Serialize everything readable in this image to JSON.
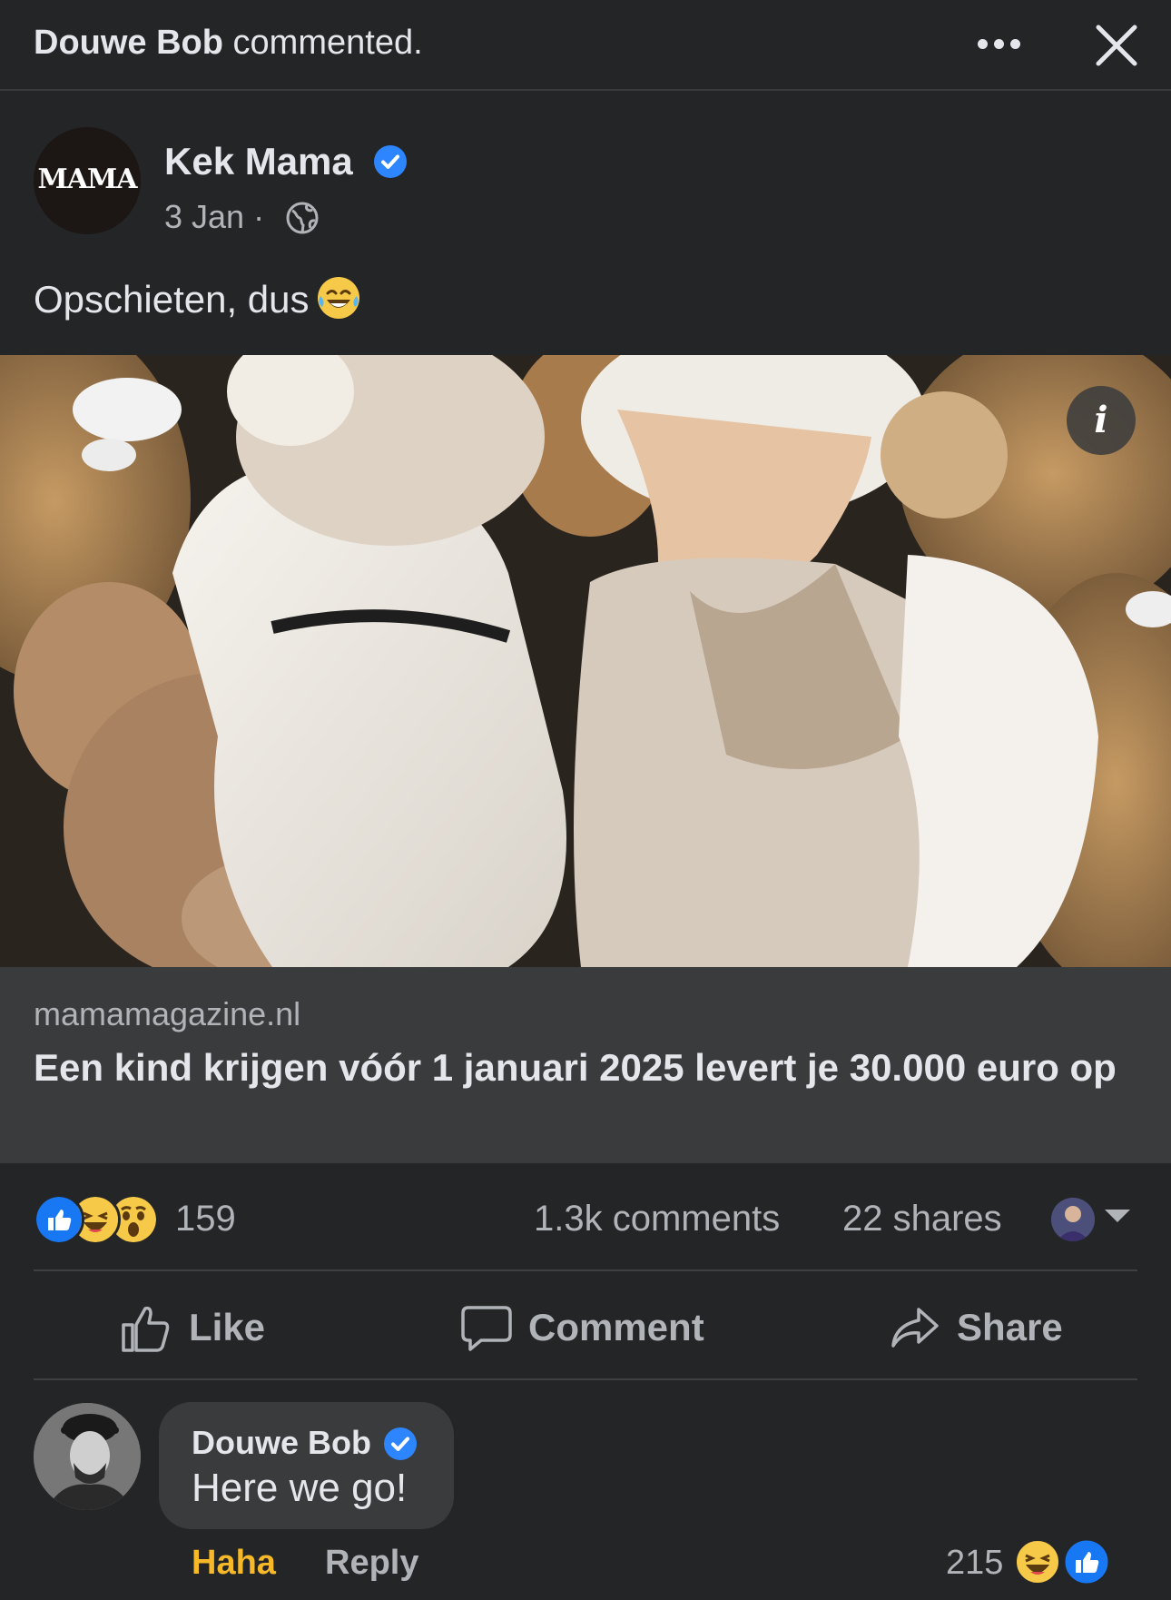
{
  "header": {
    "actor": "Douwe Bob",
    "action": "commented.",
    "more_icon": "more-dots-icon",
    "close_icon": "close-icon"
  },
  "post": {
    "page_avatar_text": "MAMA",
    "page_name": "Kek Mama",
    "date": "3 Jan",
    "separator": "·",
    "audience_icon": "globe-icon",
    "text": "Opschieten, dus",
    "text_emoji": "face-with-tears-of-joy",
    "photo_info_label": "i",
    "link": {
      "domain": "mamamagazine.nl",
      "title": "Een kind krijgen vóór 1 januari 2025 levert je 30.000 euro op"
    }
  },
  "stats": {
    "reaction_types": [
      "like",
      "haha",
      "wow"
    ],
    "reactions_count": "159",
    "comments": "1.3k comments",
    "shares": "22 shares"
  },
  "actions": {
    "like": "Like",
    "comment": "Comment",
    "share": "Share"
  },
  "comment": {
    "author": "Douwe Bob",
    "text": "Here we go!",
    "user_reaction": "Haha",
    "reply": "Reply",
    "reactions_count": "215",
    "reaction_types": [
      "haha",
      "like"
    ]
  },
  "colors": {
    "background": "#242526",
    "card": "#3a3b3c",
    "verified": "#2d86ff",
    "haha_active": "#f7b928",
    "muted_text": "#b0b3b8"
  }
}
